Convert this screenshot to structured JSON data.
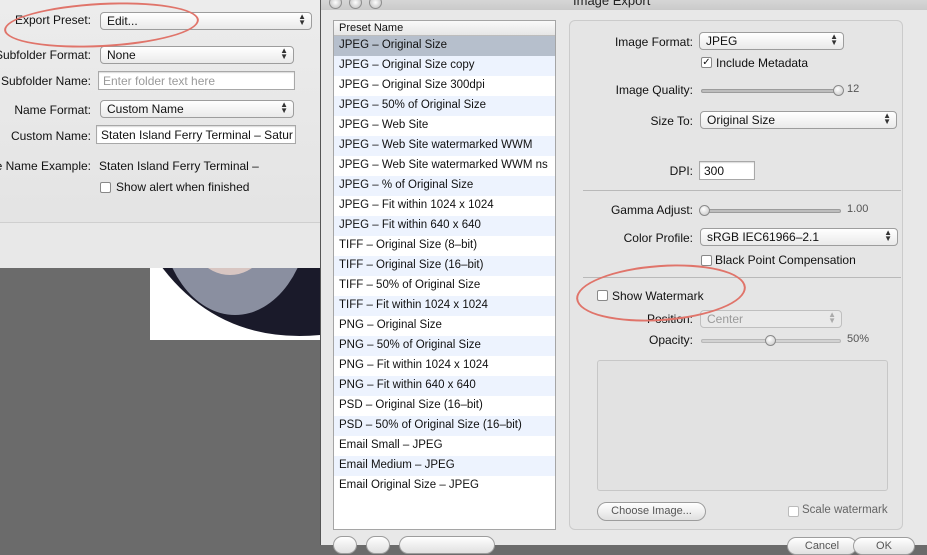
{
  "export_panel": {
    "export_preset_label": "Export Preset:",
    "export_preset_value": "Edit...",
    "subfolder_format_label": "Subfolder Format:",
    "subfolder_format_value": "None",
    "subfolder_name_label": "Subfolder Name:",
    "subfolder_name_placeholder": "Enter folder text here",
    "name_format_label": "Name Format:",
    "name_format_value": "Custom Name",
    "custom_name_label": "Custom Name:",
    "custom_name_value": "Staten Island Ferry Terminal – Satur",
    "file_name_example_label": "File Name Example:",
    "file_name_example_value": "Staten Island Ferry Terminal –",
    "show_alert_label": "Show alert when finished",
    "show_alert_checked": false
  },
  "dialog": {
    "title": "Image Export",
    "preset_list": {
      "header": "Preset Name",
      "items": [
        "JPEG – Original Size",
        "JPEG – Original Size copy",
        "JPEG – Original Size 300dpi",
        "JPEG – 50% of Original Size",
        "JPEG – Web Site",
        "JPEG – Web Site watermarked WWM",
        "JPEG – Web Site watermarked WWM ns",
        "JPEG – % of Original Size",
        "JPEG – Fit within 1024 x 1024",
        "JPEG – Fit within 640 x 640",
        "TIFF – Original Size (8–bit)",
        "TIFF – Original Size (16–bit)",
        "TIFF – 50% of Original Size",
        "TIFF – Fit within 1024 x 1024",
        "PNG – Original Size",
        "PNG – 50% of Original Size",
        "PNG – Fit within 1024 x 1024",
        "PNG – Fit within 640 x 640",
        "PSD – Original Size (16–bit)",
        "PSD – 50% of Original Size (16–bit)",
        "Email Small – JPEG",
        "Email Medium – JPEG",
        "Email Original Size – JPEG"
      ],
      "selected_index": 0
    },
    "settings": {
      "image_format_label": "Image Format:",
      "image_format_value": "JPEG",
      "include_metadata_label": "Include Metadata",
      "include_metadata_checked": true,
      "image_quality_label": "Image Quality:",
      "image_quality_value": "12",
      "image_quality_fraction": 1.0,
      "size_to_label": "Size To:",
      "size_to_value": "Original Size",
      "dpi_label": "DPI:",
      "dpi_value": "300",
      "gamma_label": "Gamma Adjust:",
      "gamma_value": "1.00",
      "gamma_fraction": 0.0,
      "color_profile_label": "Color Profile:",
      "color_profile_value": "sRGB IEC61966–2.1",
      "black_point_label": "Black Point Compensation",
      "black_point_checked": false,
      "show_watermark_label": "Show Watermark",
      "show_watermark_checked": false,
      "position_label": "Position:",
      "position_value": "Center",
      "opacity_label": "Opacity:",
      "opacity_value": "50%",
      "opacity_fraction": 0.5,
      "choose_image_label": "Choose Image...",
      "scale_watermark_label": "Scale watermark",
      "scale_watermark_checked": false
    },
    "bottom_buttons": {
      "cancel_label": "Cancel",
      "ok_label": "OK"
    }
  },
  "colors": {
    "annotation": "#e0746a",
    "selected_row": "#b6bfcc",
    "alt_row": "#edf3fe"
  }
}
